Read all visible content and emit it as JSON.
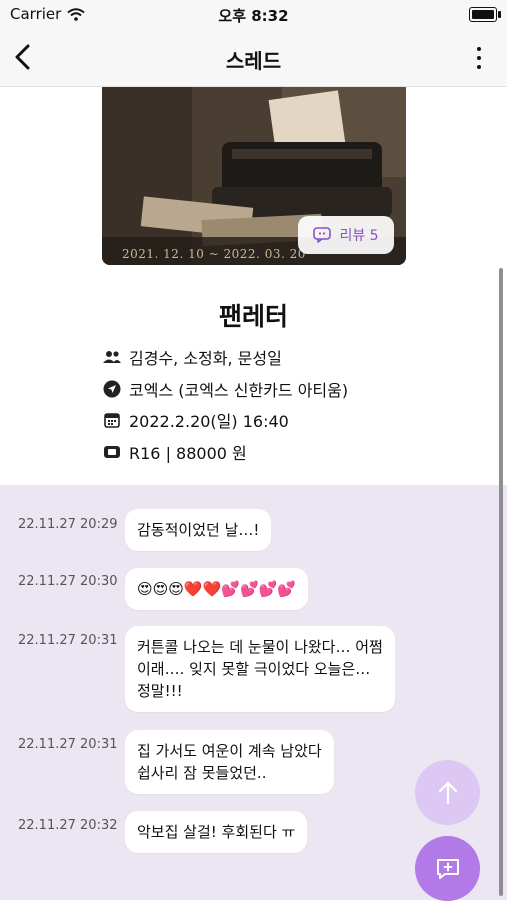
{
  "status_bar": {
    "carrier": "Carrier",
    "time": "오후 8:32"
  },
  "nav": {
    "title": "스레드"
  },
  "poster": {
    "dates": "2021. 12. 10 ~ 2022. 03. 20",
    "review_label": "리뷰 5"
  },
  "show": {
    "title": "팬레터",
    "cast": "김경수, 소정화, 문성일",
    "venue": "코엑스 (코엑스 신한카드 아티움)",
    "datetime": "2022.2.20(일) 16:40",
    "rating_price": "R16 | 88000 원"
  },
  "messages": [
    {
      "time": "22.11.27 20:29",
      "text": "감동적이었던 날…!"
    },
    {
      "time": "22.11.27 20:30",
      "text": "😍😍😍❤️❤️💕💕💕💕"
    },
    {
      "time": "22.11.27 20:31",
      "text": "커튼콜 나오는 데 눈물이 나왔다… 어쩜\n이래…. 잊지 못할 극이었다 오늘은…\n정말!!!"
    },
    {
      "time": "22.11.27 20:31",
      "text": "집 가서도 여운이 계속 남았다\n쉽사리 잠 못들었던.."
    },
    {
      "time": "22.11.27 20:32",
      "text": "악보집 살걸! 후회된다 ㅠ"
    }
  ],
  "colors": {
    "accent": "#b27ae6",
    "accent_light": "#dcc8f2",
    "chat_bg": "#ece6f2"
  }
}
